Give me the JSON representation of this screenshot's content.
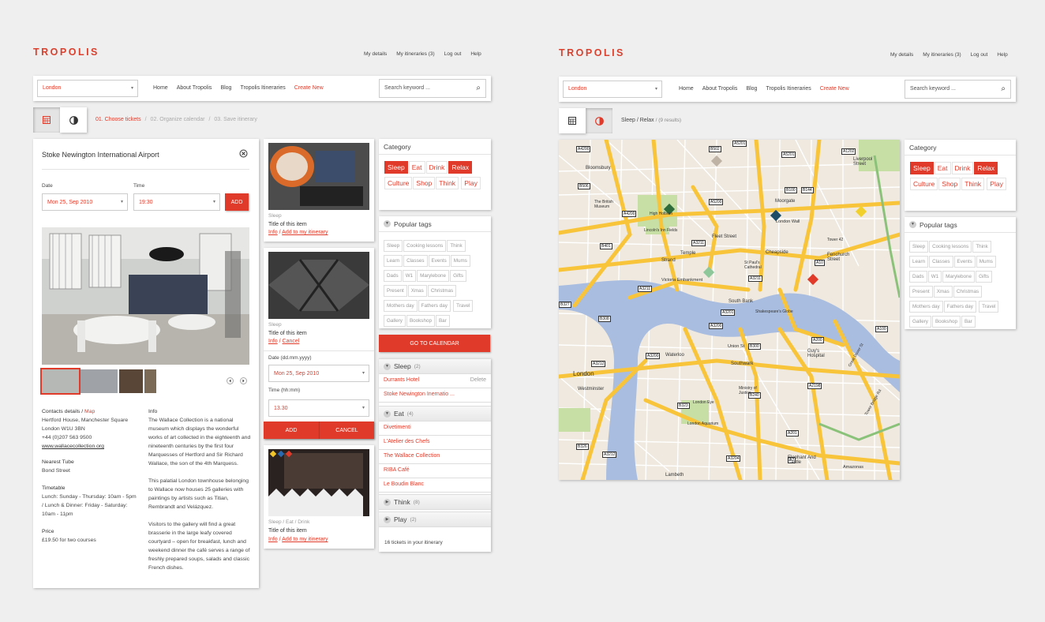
{
  "brand": "TROPOLIS",
  "top_links": [
    "My details",
    "My itineraries (3)",
    "Log out",
    "Help"
  ],
  "city": "London",
  "nav": [
    "Home",
    "About Tropolis",
    "Blog",
    "Tropolis Itineraries"
  ],
  "nav_create": "Create New",
  "search_placeholder": "Search keyword ...",
  "steps": {
    "s1": "01. Choose tickets",
    "s2": "02. Organize calendar",
    "s3": "03. Save itinerary",
    "sep": "/"
  },
  "detail": {
    "title": "Stoke Newington International Airport",
    "date_label": "Date",
    "time_label": "Time",
    "date_value": "Mon 25, Sep 2010",
    "time_value": "19:30",
    "add": "ADD",
    "contacts_label": "Contacts details /",
    "map_link": "Map",
    "address1": "Hertford House, Manchester Square",
    "address2": "London W1U 3BN",
    "phone": "+44 (0)207 563 9500",
    "web": "www.wallacecollection.org",
    "tube_label": "Nearest Tube",
    "tube": "Bond Street",
    "timetable_label": "Timetable",
    "timetable1": "Lunch: Sunday - Thursday: 10am - 5pm",
    "timetable2": "/ Lunch & Dinner: Friday - Saturday:",
    "timetable3": "10am - 11pm",
    "price_label": "Price",
    "price": "£19.50 for two courses",
    "info_label": "Info",
    "info_p1": "The Wallace Collection is a national museum which displays the wonderful works of art collected in the eighteenth and nineteenth centuries by the first four Marquesses of Hertford and Sir Richard Wallace, the son of the 4th Marquess.",
    "info_p2": "This palatial London townhouse belonging to Wallace now houses 25 galleries with paintings by artists such as Titian, Rembrandt and Velázquez.",
    "info_p3": "Visitors to the gallery will find a great brasserie in the large leafy covered courtyard – open for breakfast, lunch and weekend dinner the café serves a range of freshly prepared soups, salads and classic French dishes."
  },
  "tickets": [
    {
      "category": "Sleep",
      "title": "Title of this item",
      "link1": "Info",
      "sep": "/",
      "link2": "Add to my itinerary"
    },
    {
      "category": "Sleep",
      "title": "Title of this item",
      "link1": "Info",
      "sep": "/",
      "link2": "Cancel",
      "date_label": "Date (dd.mm.yyyy)",
      "date_value": "Mon 25, Sep 2010",
      "time_label": "Time (hh:mm)",
      "time_value": "13.30",
      "add": "ADD",
      "cancel": "CANCEL"
    },
    {
      "category": "Sleep / Eat / Drink",
      "title": "Title of this item",
      "link1": "Info",
      "sep": "/",
      "link2": "Add to my itinerary"
    }
  ],
  "category_title": "Category",
  "categories": [
    "Sleep",
    "Eat",
    "Drink",
    "Relax",
    "Culture",
    "Shop",
    "Think",
    "Play"
  ],
  "tags_title": "Popular tags",
  "tags": [
    "Sleep",
    "Cooking lessons",
    "Think",
    "Learn",
    "Classes",
    "Events",
    "Mums",
    "Dads",
    "W1",
    "Marylebone",
    "Gifts",
    "Present",
    "Xmas",
    "Christmas",
    "Mothers day",
    "Fathers day",
    "Travel",
    "Gallery",
    "Bookshop",
    "Bar"
  ],
  "go_calendar": "GO TO CALENDAR",
  "itinerary": {
    "sleep_label": "Sleep",
    "sleep_count": "(2)",
    "sleep_items": [
      "Durrants Hotel",
      "Stoke Newington Inernatio ..."
    ],
    "delete": "Delete",
    "eat_label": "Eat",
    "eat_count": "(4)",
    "eat_items": [
      "Divetimenti",
      "L'Atelier des Chefs",
      "The Wallace Collection",
      "RIBA Café",
      "Le Boudin Blanc"
    ],
    "think_label": "Think",
    "think_count": "(8)",
    "play_label": "Play",
    "play_count": "(2)",
    "footer": "16 tickets in your itinerary"
  },
  "map_view": {
    "breadcrumb": "Sleep / Relax",
    "results": "/ (9 results)"
  },
  "map_labels": [
    "Bloomsbury",
    "The British Museum",
    "Lincoln's Inn Fields",
    "High Holborn",
    "Fleet Street",
    "London Wall",
    "Moorgate",
    "Liverpool Street",
    "Cheapside",
    "Fenchurch Street",
    "St Paul's Cathedral",
    "Temple",
    "Strand",
    "Victoria Embankment",
    "South Bank",
    "Shakespeare's Globe",
    "Waterloo",
    "Southwark",
    "London",
    "Westminster",
    "Lambeth",
    "Elephant And Castle",
    "Guy's Hospital",
    "London Eye",
    "London Aquarium",
    "Tower 42",
    "Ministry of Justice",
    "Union St",
    "Amazonas",
    "Great Dover St",
    "Tower Bridge Rd"
  ],
  "colors": {
    "accent": "#e03b2a",
    "map_road": "#f8c43a",
    "map_river": "#a9bde0",
    "map_park": "#c7dfa5"
  }
}
